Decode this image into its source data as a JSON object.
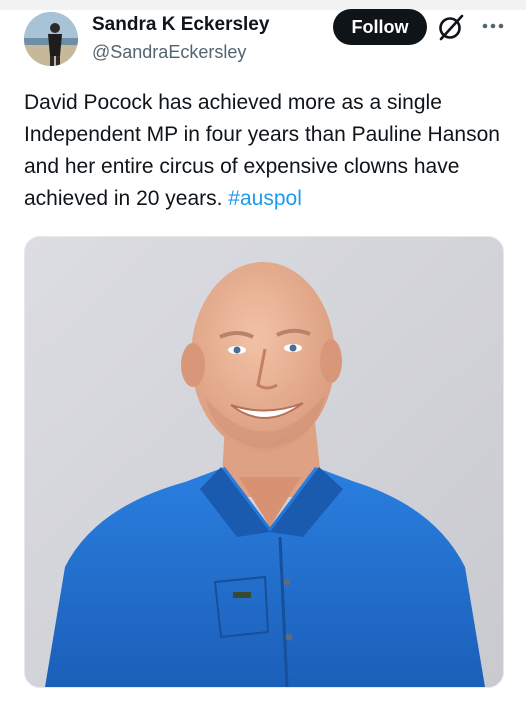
{
  "author": {
    "display_name": "Sandra K Eckersley",
    "handle": "@SandraEckersley"
  },
  "actions": {
    "follow_label": "Follow",
    "grok_icon": "grok-icon",
    "more_icon": "more-icon"
  },
  "tweet": {
    "text": "David Pocock has achieved more as a single Independent MP in four years than Pauline Hanson and her entire circus of expensive clowns have achieved in 20 years. ",
    "hashtag": "#auspol"
  },
  "media": {
    "description_icon": "photo-of-smiling-bald-man-in-blue-shirt"
  },
  "colors": {
    "link": "#1d9bf0",
    "text": "#0f1419",
    "secondary": "#536471",
    "shirt": "#1f6fd0"
  }
}
